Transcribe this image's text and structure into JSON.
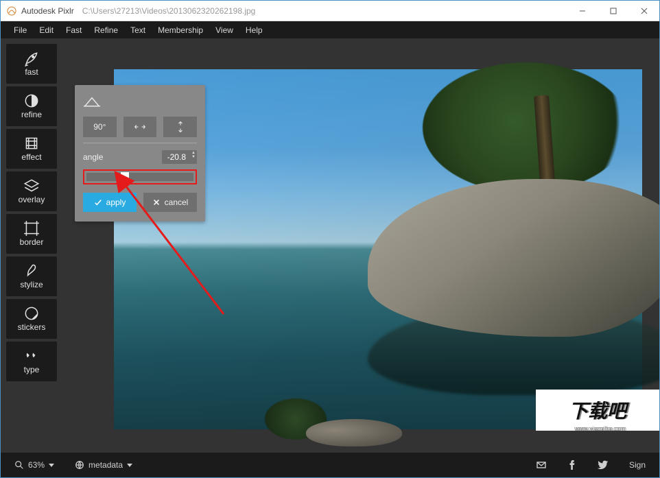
{
  "titlebar": {
    "app_name": "Autodesk Pixlr",
    "file_path": "C:\\Users\\27213\\Videos\\2013062320262198.jpg"
  },
  "menus": [
    "File",
    "Edit",
    "Fast",
    "Refine",
    "Text",
    "Membership",
    "View",
    "Help"
  ],
  "tools": [
    {
      "id": "fast",
      "label": "fast",
      "icon": "rocket"
    },
    {
      "id": "refine",
      "label": "refine",
      "icon": "circle-half"
    },
    {
      "id": "effect",
      "label": "effect",
      "icon": "film"
    },
    {
      "id": "overlay",
      "label": "overlay",
      "icon": "layers"
    },
    {
      "id": "border",
      "label": "border",
      "icon": "frame"
    },
    {
      "id": "stylize",
      "label": "stylize",
      "icon": "brush"
    },
    {
      "id": "stickers",
      "label": "stickers",
      "icon": "sticker"
    },
    {
      "id": "type",
      "label": "type",
      "icon": "quote"
    }
  ],
  "rotate_panel": {
    "icon": "rotate-crop",
    "btn_90": "90°",
    "angle_label": "angle",
    "angle_value": "-20.8",
    "slider_percent": 30,
    "apply_label": "apply",
    "cancel_label": "cancel"
  },
  "statusbar": {
    "zoom": "63%",
    "metadata_label": "metadata",
    "sign_label": "Sign"
  },
  "watermark": {
    "text": "下载吧",
    "sub": "www.xiazaiba.com"
  }
}
